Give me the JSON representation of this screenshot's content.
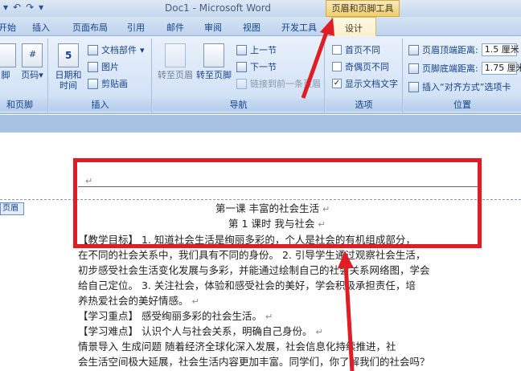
{
  "window": {
    "title": "Doc1 - Microsoft Word",
    "context_tab": "页眉和页脚工具"
  },
  "tabs": [
    "开始",
    "插入",
    "页面布局",
    "引用",
    "邮件",
    "审阅",
    "视图",
    "开发工具",
    "设计"
  ],
  "active_tab": "设计",
  "groups": {
    "header_footer": {
      "label": "和页脚",
      "footer": "页脚",
      "header_frag": "脚"
    },
    "insert": {
      "label": "插入",
      "page_number": "页码",
      "date_time_1": "日期和",
      "date_time_2": "时间",
      "doc_parts": "文档部件",
      "picture": "图片",
      "clipart": "剪贴画"
    },
    "nav": {
      "label": "导航",
      "goto_header": "转至页眉",
      "goto_footer": "转至页脚",
      "prev": "上一节",
      "next": "下一节",
      "link_prev": "链接到前一条页眉"
    },
    "options": {
      "label": "选项",
      "first_page": "首页不同",
      "odd_even": "奇偶页不同",
      "show_text": "显示文档文字"
    },
    "position": {
      "label": "位置",
      "header_dist_label": "页眉顶端距离:",
      "header_dist": "1.5 厘米",
      "footer_dist_label": "页脚底端距离:",
      "footer_dist": "1.75 厘米",
      "insert_tab": "插入“对齐方式”选项卡"
    }
  },
  "document": {
    "header_tag": "页眉",
    "title": "第一课 丰富的社会生活",
    "subtitle": "第 1 课时 我与社会",
    "lines": [
      "【教学目标】  1. 知道社会生活是绚丽多彩的，个人是社会的有机组成部分，",
      "在不同的社会关系中，我们具有不同的身份。  2. 引导学生通过观察社会生活，",
      "初步感受社会生活变化发展与多彩，并能通过绘制自己的社会关系网络图，学会",
      "给自己定位。  3. 关注社会，体验和感受社会的美好，学会积极承担责任，培",
      "养热爱社会的美好情感。",
      "【学习重点】  感受绚丽多彩的社会生活。",
      "【学习难点】  认识个人与社会关系，明确自己身份。",
      "  情景导入  生成问题   随着经济全球化深入发展，社会信息化持续推进，社",
      "会生活空间极大延展，社会生活内容更加丰富。同学们，你了解我们的社会吗？"
    ]
  }
}
